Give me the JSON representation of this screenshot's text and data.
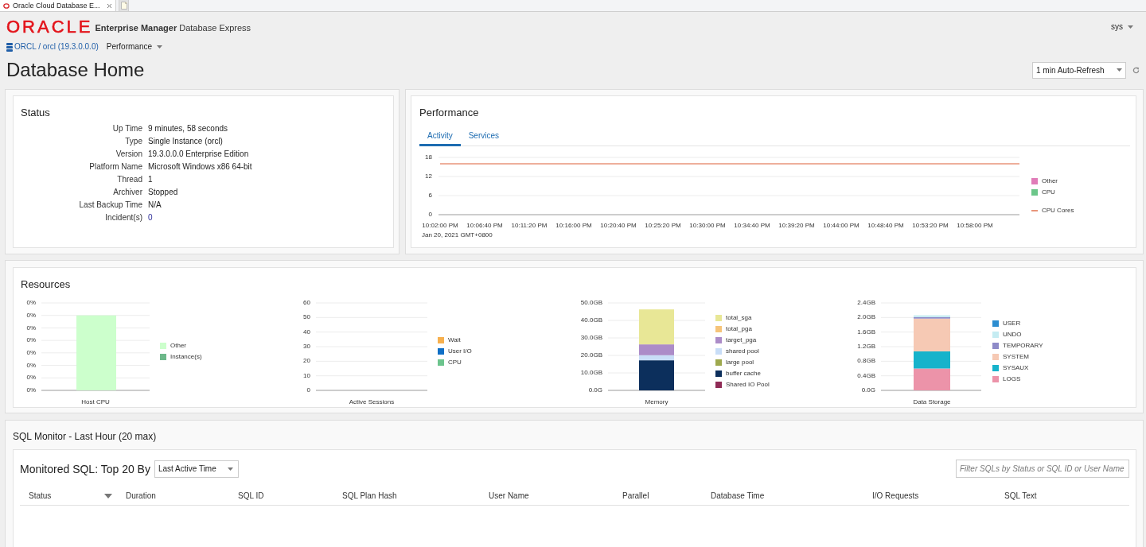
{
  "browser_tab": {
    "title": "Oracle Cloud Database E...",
    "selected": true
  },
  "header": {
    "logo": "ORACLE",
    "product": "**Enterprise Manager** Database Express",
    "user_menu": "sys"
  },
  "navigation": {
    "database_link": "ORCL / orcl (19.3.0.0.0)",
    "menu": "Performance"
  },
  "page": {
    "title": "Database Home",
    "refresh_select": {
      "value": "1 min Auto-Refresh"
    }
  },
  "status": {
    "title": "Status",
    "rows": [
      {
        "label": "Up Time",
        "value": "9 minutes, 58 seconds",
        "kind": "text"
      },
      {
        "label": "Type",
        "value": "Single Instance (orcl)",
        "kind": "text"
      },
      {
        "label": "Version",
        "value": "19.3.0.0.0 Enterprise Edition",
        "kind": "text"
      },
      {
        "label": "Platform Name",
        "value": "Microsoft Windows x86 64-bit",
        "kind": "text"
      },
      {
        "label": "Thread",
        "value": "1",
        "kind": "text"
      },
      {
        "label": "Archiver",
        "value": "Stopped",
        "kind": "text"
      },
      {
        "label": "Last Backup Time",
        "value": "N/A",
        "kind": "text"
      },
      {
        "label": "Incident(s)",
        "value": "0",
        "kind": "link"
      }
    ]
  },
  "performance": {
    "title": "Performance",
    "tabs": [
      {
        "label": "Activity",
        "selected": true
      },
      {
        "label": "Services",
        "selected": false
      }
    ],
    "legend": [
      {
        "label": "Other",
        "color": "#e07cb8"
      },
      {
        "label": "CPU",
        "color": "#6cc68a"
      }
    ],
    "date_label": "Jan 20, 2021 GMT+0800",
    "chart_data": {
      "type": "line",
      "grid": true,
      "legend": "right",
      "categories": [
        "10:02:00 PM",
        "10:06:40 PM",
        "10:11:20 PM",
        "10:16:00 PM",
        "10:20:40 PM",
        "10:25:20 PM",
        "10:30:00 PM",
        "10:34:40 PM",
        "10:39:20 PM",
        "10:44:00 PM",
        "10:48:40 PM",
        "10:53:20 PM",
        "10:58:00 PM",
        null
      ],
      "ylim": [
        0,
        18
      ],
      "yticks": [
        0,
        6,
        12,
        18
      ],
      "series": [
        {
          "name": "CPU Cores",
          "color": "#e8957a",
          "values": [
            16,
            16,
            16,
            16,
            16,
            16,
            16,
            16,
            16,
            16,
            16,
            16,
            16,
            16
          ]
        }
      ]
    }
  },
  "resources": {
    "title": "Resources",
    "charts": [
      {
        "kind": "picture",
        "label": "Host CPU",
        "y_labels": [
          "0%",
          "0%",
          "0%",
          "0%",
          "0%",
          "0%",
          "0%",
          "0%"
        ],
        "legend": [
          {
            "label": "Other",
            "color": "#ccffcc"
          },
          {
            "label": "Instance(s)",
            "color": "#6db88a"
          }
        ]
      },
      {
        "kind": "chart",
        "chart_data": {
          "type": "bar",
          "stacked": true,
          "grid": true,
          "legend": "right",
          "categories": [
            "Active Sessions"
          ],
          "ylim": [
            0,
            60
          ],
          "yticks": [
            0,
            10,
            20,
            30,
            40,
            50,
            60
          ],
          "series": [
            {
              "name": "Wait",
              "color": "#f7b04e",
              "values": [
                0
              ]
            },
            {
              "name": "User I/O",
              "color": "#0f6fc6",
              "values": [
                0
              ]
            },
            {
              "name": "CPU",
              "color": "#6cc48d",
              "values": [
                0
              ]
            }
          ]
        }
      },
      {
        "kind": "chart",
        "chart_data": {
          "type": "bar",
          "stacked": true,
          "grid": true,
          "legend": "right",
          "categories": [
            "Memory"
          ],
          "ylim": [
            0,
            50
          ],
          "yticks": [
            {
              "value": 0,
              "label": "0.0G"
            },
            {
              "value": 10,
              "label": "10.0GB"
            },
            {
              "value": 20,
              "label": "20.0GB"
            },
            {
              "value": 30,
              "label": "30.0GB"
            },
            {
              "value": 40,
              "label": "40.0GB"
            },
            {
              "value": 50,
              "label": "50.0GB"
            }
          ],
          "series": [
            {
              "name": "total_sga",
              "color": "#e8e796",
              "values": [
                20
              ]
            },
            {
              "name": "total_pga",
              "color": "#f6c47a",
              "values": [
                0
              ]
            },
            {
              "name": "target_pga",
              "color": "#ac8cc8",
              "values": [
                6.2
              ]
            },
            {
              "name": "shared pool",
              "color": "#c8ddf7",
              "values": [
                2.9
              ]
            },
            {
              "name": "large pool",
              "color": "#9ea94e",
              "values": [
                0
              ]
            },
            {
              "name": "buffer cache",
              "color": "#0c2f5c",
              "values": [
                17.2
              ]
            },
            {
              "name": "Shared IO Pool",
              "color": "#8f2b56",
              "values": [
                0
              ]
            }
          ]
        }
      },
      {
        "kind": "chart",
        "chart_data": {
          "type": "bar",
          "stacked": true,
          "grid": true,
          "legend": "right",
          "categories": [
            "Data Storage"
          ],
          "ylim": [
            0,
            2.4
          ],
          "yticks": [
            {
              "value": 0,
              "label": "0.0G"
            },
            {
              "value": 0.4,
              "label": "0.4GB"
            },
            {
              "value": 0.8,
              "label": "0.8GB"
            },
            {
              "value": 1.2,
              "label": "1.2GB"
            },
            {
              "value": 1.6,
              "label": "1.6GB"
            },
            {
              "value": 2,
              "label": "2.0GB"
            },
            {
              "value": 2.4,
              "label": "2.4GB"
            }
          ],
          "series": [
            {
              "name": "USER",
              "color": "#2c8dd0",
              "values": [
                0
              ]
            },
            {
              "name": "UNDO",
              "color": "#c5ecf2",
              "values": [
                0.05
              ]
            },
            {
              "name": "TEMPORARY",
              "color": "#8e8bc8",
              "values": [
                0.04
              ]
            },
            {
              "name": "SYSTEM",
              "color": "#f6c9b4",
              "values": [
                0.9
              ]
            },
            {
              "name": "SYSAUX",
              "color": "#16b3cb",
              "values": [
                0.47
              ]
            },
            {
              "name": "LOGS",
              "color": "#ec93a9",
              "values": [
                0.6
              ]
            }
          ]
        }
      }
    ]
  },
  "sql_monitor": {
    "title": "SQL Monitor - Last Hour (20 max)",
    "heading": "Monitored SQL: Top 20 By",
    "sort_select": {
      "value": "Last Active Time"
    },
    "filter": {
      "placeholder": "Filter SQLs by Status or SQL ID or User Name"
    },
    "columns": [
      {
        "label": "Status",
        "menu": true
      },
      {
        "label": "Duration",
        "menu": false
      },
      {
        "label": "SQL ID",
        "menu": false
      },
      {
        "label": "SQL Plan Hash",
        "menu": false
      },
      {
        "label": "User Name",
        "menu": false
      },
      {
        "label": "Parallel",
        "menu": false
      },
      {
        "label": "Database Time",
        "menu": false
      },
      {
        "label": "I/O Requests",
        "menu": false
      },
      {
        "label": "SQL Text",
        "menu": false
      }
    ]
  }
}
